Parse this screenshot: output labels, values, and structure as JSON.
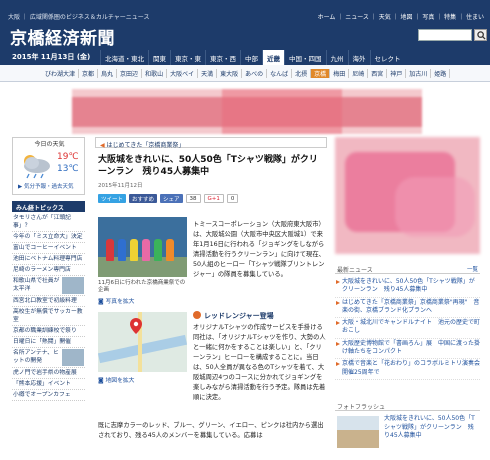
{
  "topbar": {
    "tagline": "大阪 ｜ 広域関係圏のビジネス＆カルチャーニュース",
    "links": "ホーム ｜ ニュース ｜ 天気 ｜ 地図 ｜ 写真 ｜ 特集 ｜ 住まい"
  },
  "header": {
    "logo": "京橋経済新聞",
    "search_placeholder": ""
  },
  "datebar": {
    "date": "2015年 11月13日 (金)",
    "areas": [
      "北海道・東北",
      "関東",
      "東京・東",
      "東京・西",
      "中部",
      "近畿",
      "中国・四国",
      "九州",
      "海外",
      "セレクト"
    ],
    "active_area": "近畿"
  },
  "subnav": {
    "items": [
      "びわ湖大津",
      "京都",
      "烏丸",
      "京田辺",
      "和歌山",
      "大阪ベイ",
      "天満",
      "東大阪",
      "あべの",
      "なんば",
      "北摂",
      "京橋",
      "梅田",
      "尼崎",
      "西宮",
      "神戸",
      "加古川",
      "姫路"
    ],
    "active": "京橋"
  },
  "weather": {
    "title": "今日の天気",
    "high": "19℃",
    "low": "13℃",
    "link": "▶ 気分予報・過去天気"
  },
  "picks": {
    "title": "みん経トピックス",
    "items": [
      "タモリさんが「江頭記事」？",
      "今年の「ミス立命大」決定",
      "富山でコーヒーイベント",
      "池田にベトナム料理専門店",
      "尼崎のラーメン専門店",
      "和歌山県で社員が太平洋",
      "西宮北口教室で初級料理",
      "高校生が無償でサッカー教室",
      "京都の職業訓練校で祭り",
      "日曜日に「熱闘」開催",
      "名所アンテナ、ヒットの開発",
      "虎ノ門で岩手県の物産展",
      "「熊本応援」イベント",
      "小樽でオープンカフェ"
    ]
  },
  "article": {
    "breadcrumb": "はじめてきた「京橋商業祭」",
    "headline": "大阪城をきれいに、50人50色「Tシャツ戦隊」がクリーンラン　残り45人募集中",
    "pubdate": "2015年11月12日",
    "share": {
      "tweet": "ツイート",
      "like": "おすすめ",
      "share": "シェア",
      "count": "38",
      "gplus": "G+1",
      "gcount": "0"
    },
    "photo_caption": "11月6日に行われた京橋商業祭での企画",
    "photo_link": "写真を拡大",
    "map_link": "地図を拡大",
    "para1": "トミースコーポレーション（大阪府東大阪市）は、大阪城公園（大阪市中央区大阪城1）で来年1月16日に行われる「ジョギングをしながら清掃活動を行うクリーンラン」に向けて現在、50人組のヒーロー「Tシャツ戦隊ブリントレンジャー」の隊員を募集している。",
    "section_title": "レッドレンジャー登場",
    "para2": "オリジナルTシャツの作成サービスを手掛ける同社は、「オリジナルTシャツを作り、大勢の人と一緒に何かをすることは楽しい」と、「クリーンラン」ヒーローを構成することに。当日は、50人全員が異なる色のTシャツを着て、大阪城周辺4つのコースに分かれてジョギングを楽しみながら清掃活動を行う予定。隊員は先着順に決定。",
    "para3": "既に志摩カラーのレッド、ブルー、グリーン、イエロー、ピンクは社内から選出されており、残る45人のメンバーを募集している。応募は"
  },
  "latest_news": {
    "title": "最新ニュース",
    "more": "一覧",
    "items": [
      "大阪城をきれいに、50人50色「Tシャツ戦隊」がクリーンラン　残り45人募集中",
      "はじめてきた「京橋商業祭」京橋商業祭\"再現\"　音楽の街、京橋ブランド化プランへ",
      "大阪・城北川でキャンドルナイト　池元の歴史で町おこし",
      "大阪歴史博物館で「書画ろん」展　中国に渡った掛け軸たちをコンパクト",
      "京橋で音楽と「花おわり」のコラボルミトリ演奏会　開催25周年で"
    ]
  },
  "flash": {
    "title": "フォトフラッシュ",
    "text": "大阪城をきれいに、50人50色「Tシャツ戦隊」がクリーンラン　残り45人募集中"
  },
  "colors": {
    "navy": "#1d3b6a",
    "accent": "#e06a2a",
    "link": "#1d4f9c"
  }
}
